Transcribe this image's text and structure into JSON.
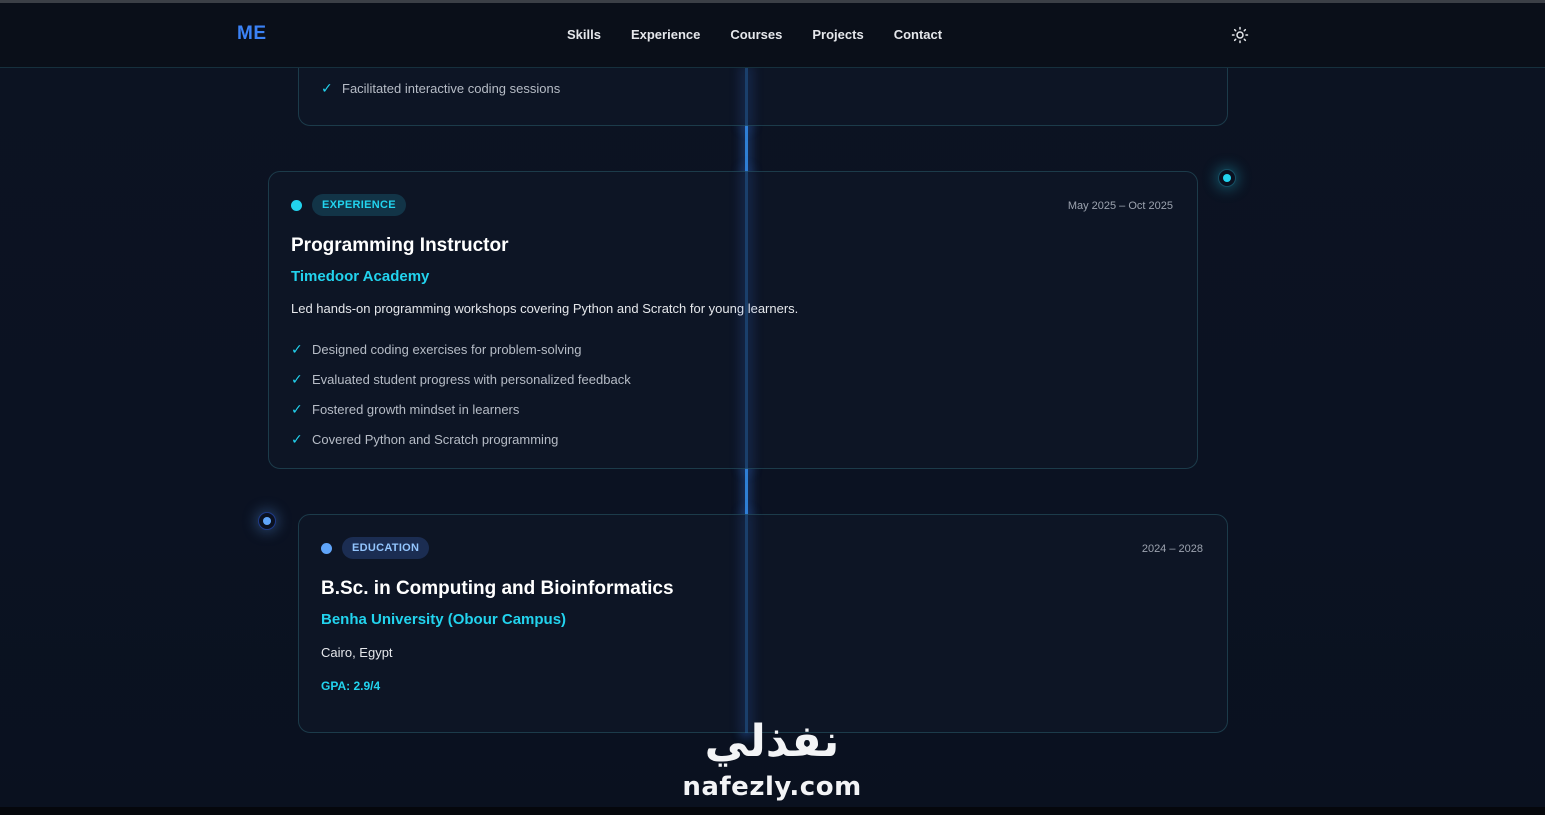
{
  "header": {
    "logo": "ME",
    "nav": [
      "Skills",
      "Experience",
      "Courses",
      "Projects",
      "Contact"
    ],
    "theme_toggle_icon": "sun-icon"
  },
  "timeline": {
    "previous_card": {
      "bullets": [
        "Facilitated interactive coding sessions"
      ]
    },
    "experience_card": {
      "badge": "EXPERIENCE",
      "date": "May 2025 – Oct 2025",
      "title": "Programming Instructor",
      "organization": "Timedoor Academy",
      "description": "Led hands-on programming workshops covering Python and Scratch for young learners.",
      "bullets": [
        "Designed coding exercises for problem-solving",
        "Evaluated student progress with personalized feedback",
        "Fostered growth mindset in learners",
        "Covered Python and Scratch programming"
      ]
    },
    "education_card": {
      "badge": "EDUCATION",
      "date": "2024 – 2028",
      "title": "B.Sc. in Computing and Bioinformatics",
      "organization": "Benha University (Obour Campus)",
      "location": "Cairo, Egypt",
      "gpa": "GPA: 2.9/4"
    }
  },
  "watermark": {
    "arabic": "نفذلي",
    "latin": "nafezly.com"
  },
  "colors": {
    "accent_cyan": "#22d3ee",
    "accent_blue": "#3b82f6",
    "background": "#0b1120"
  }
}
